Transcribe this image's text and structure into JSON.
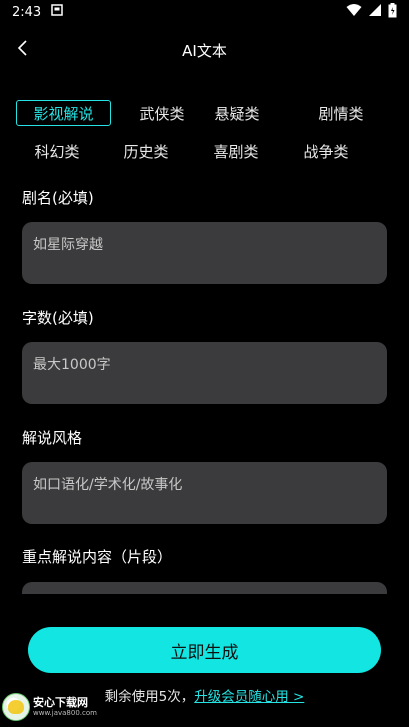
{
  "status_bar": {
    "time": "2:43",
    "left_icons": [
      "sim-card-icon"
    ],
    "right_icons": [
      "wifi-icon",
      "signal-icon",
      "battery-icon"
    ]
  },
  "app_bar": {
    "title": "AI文本",
    "back_icon": "chevron-left-icon"
  },
  "tabs": {
    "selected": "影视解说",
    "row1": [
      "影视解说",
      "武侠类",
      "悬疑类",
      "剧情类"
    ],
    "row2": [
      "科幻类",
      "历史类",
      "喜剧类",
      "战争类"
    ]
  },
  "form": {
    "title": {
      "label": "剧名(必填)",
      "placeholder": "如星际穿越"
    },
    "word_count": {
      "label": "字数(必填)",
      "placeholder": "最大1000字"
    },
    "style": {
      "label": "解说风格",
      "placeholder": "如口语化/学术化/故事化"
    },
    "focus": {
      "label": "重点解说内容（片段）",
      "placeholder": ""
    }
  },
  "actions": {
    "generate": "立即生成",
    "remaining": "剩余使用5次，",
    "upgrade": "升级会员随心用 >"
  },
  "watermark": {
    "name": "安心下载网",
    "url": "www.java800.com"
  },
  "colors": {
    "accent": "#25e3e3",
    "button": "#13e6e2",
    "field_bg": "#3b3b3d",
    "background": "#000000"
  }
}
